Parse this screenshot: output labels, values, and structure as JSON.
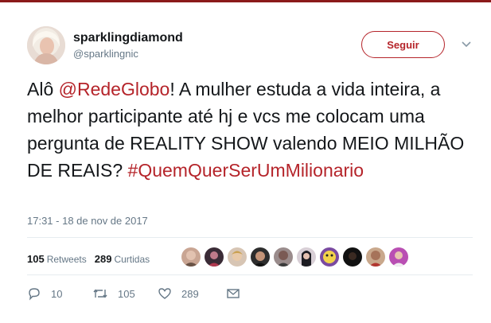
{
  "user": {
    "display_name": "sparklingdiamond",
    "handle": "@sparklingnic"
  },
  "follow_button": {
    "label": "Seguir"
  },
  "tweet": {
    "text_1": "Alô ",
    "mention": "@RedeGlobo",
    "text_2": "! A mulher estuda a vida inteira, a melhor participante até hj e vcs me colocam uma pergunta de REALITY SHOW valendo MEIO MILHÃO DE REAIS? ",
    "hashtag": "#QuemQuerSerUmMilionario"
  },
  "timestamp": "17:31 - 18 de nov de 2017",
  "stats": {
    "retweets_count": "105",
    "retweets_label": "Retweets",
    "likes_count": "289",
    "likes_label": "Curtidas"
  },
  "liker_avatars": 10,
  "actions": {
    "reply_count": "10",
    "retweet_count": "105",
    "like_count": "289"
  },
  "colors": {
    "accent": "#b5242a",
    "top_bar": "#8b1a1a",
    "muted": "#657786"
  },
  "icons": [
    "reply-icon",
    "retweet-icon",
    "heart-icon",
    "message-icon",
    "chevron-down-icon"
  ]
}
